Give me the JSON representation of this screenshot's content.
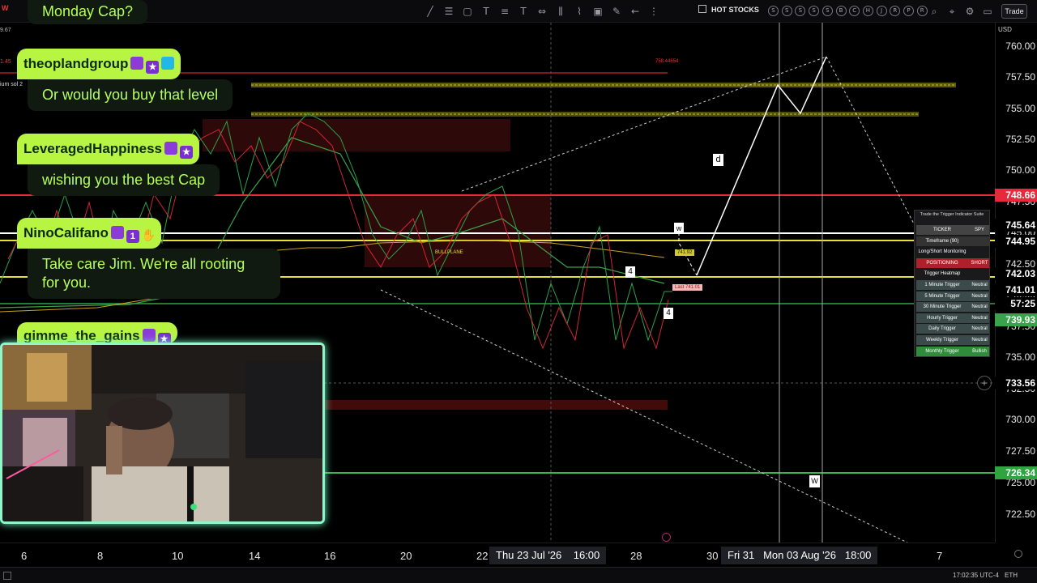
{
  "toolbar": {
    "title_fragment": "W",
    "hot_stocks_label": "HOT STOCKS",
    "trade_button": "Trade",
    "symbol_circles": [
      "S",
      "S",
      "S",
      "S",
      "S",
      "B",
      "C",
      "H",
      "J",
      "R",
      "P",
      "R"
    ],
    "tool_icons": [
      "crosshair-icon",
      "horizontal-lines-icon",
      "rectangle-icon",
      "text-T-icon",
      "fib-icon",
      "text-icon",
      "measure-icon",
      "bar-pattern-icon",
      "path-icon",
      "image-icon",
      "brush-icon",
      "arrow-left-icon",
      "more-icon"
    ],
    "right_icons": [
      "zoom-icon",
      "magnet-icon",
      "settings-icon",
      "camera-icon"
    ]
  },
  "price_axis": {
    "currency": "USD",
    "ticks": [
      "760.00",
      "757.50",
      "755.00",
      "752.50",
      "750.00",
      "747.50",
      "745.00",
      "742.50",
      "740.00",
      "737.50",
      "735.00",
      "732.50",
      "730.00",
      "727.50",
      "725.00",
      "722.50"
    ],
    "tags": [
      {
        "label": "748.66",
        "color": "#e8283c"
      },
      {
        "label": "745.64",
        "color": "#000000"
      },
      {
        "label": "744.95",
        "color": "#000000"
      },
      {
        "label": "742.03",
        "color": "#000000"
      },
      {
        "label": "741.01",
        "color": "#000000"
      },
      {
        "label": "57:25",
        "color": "#000000"
      },
      {
        "label": "739.93",
        "color": "#3aa24a"
      },
      {
        "label": "733.56",
        "color": "#000000"
      },
      {
        "label": "726.34",
        "color": "#2fa43f"
      }
    ]
  },
  "time_axis": {
    "ticks": [
      "6",
      "8",
      "10",
      "14",
      "16",
      "20",
      "22",
      "28",
      "30",
      "7"
    ],
    "crosshair_label": "Thu 23 Jul '26",
    "crosshair_time": "16:00",
    "range_start": "Fri 31",
    "range_end": "Mon 03 Aug '26",
    "range_time": "18:00"
  },
  "chart_labels": {
    "top_level": "758.44654",
    "wave_d": "d",
    "wave_4a": "4",
    "wave_4b": "4",
    "wave_w": "w",
    "wave_w2": "W",
    "bullplane": "BULLPLANE",
    "box_price": "741.92",
    "box_last": "Last 741.01"
  },
  "indicator_panel": {
    "title": "Trade the Trigger Indicator Suite",
    "rows": [
      {
        "label": "TICKER",
        "value": "SPY",
        "color": "#444444"
      },
      {
        "label": "Timeframe (90)",
        "value": "",
        "color": "#333333"
      },
      {
        "label": "Long/Short Monitoring",
        "value": "",
        "color": "#1a1a1d"
      },
      {
        "label": "POSITIONING",
        "value": "SHORT",
        "color": "#b0202a"
      },
      {
        "label": "Trigger Heatmap",
        "value": "",
        "color": "#1a1a1d"
      },
      {
        "label": "1 Minute Trigger",
        "value": "Neutral",
        "color": "#3b4a4a"
      },
      {
        "label": "5 Minute Trigger",
        "value": "Neutral",
        "color": "#3b4a4a"
      },
      {
        "label": "30 Minute Trigger",
        "value": "Neutral",
        "color": "#3b4a4a"
      },
      {
        "label": "Hourly Trigger",
        "value": "Neutral",
        "color": "#3b4a4a"
      },
      {
        "label": "Daily Trigger",
        "value": "Neutral",
        "color": "#3b4a4a"
      },
      {
        "label": "Weekly Trigger",
        "value": "Neutral",
        "color": "#3b4a4a"
      },
      {
        "label": "Monthly Trigger",
        "value": "Bullish",
        "color": "#2e8c3a"
      }
    ]
  },
  "chat": [
    {
      "name": "",
      "message": "Monday Cap?"
    },
    {
      "name": "theoplandgroup",
      "message": "Or would you buy that level"
    },
    {
      "name": "LeveragedHappiness",
      "message": "wishing you the best Cap"
    },
    {
      "name": "NinoCalifano",
      "message": "Take care Jim. We're all rooting for you."
    },
    {
      "name": "gimme_the_gains",
      "message": ""
    }
  ],
  "left_edge": {
    "price_a": "9.67",
    "price_b": "1.45",
    "label": "ium sol 2"
  },
  "status_bar": {
    "time": "17:02:35 UTC-4",
    "symbol": "ETH"
  },
  "colors": {
    "chat_name_bg": "#b7f542",
    "chat_text": "#b4ff5a",
    "webcam_border": "#8ef7c9",
    "resistance_red": "#e8283c",
    "support_green": "#2fa43f",
    "level_yellow": "#e5e23a"
  }
}
